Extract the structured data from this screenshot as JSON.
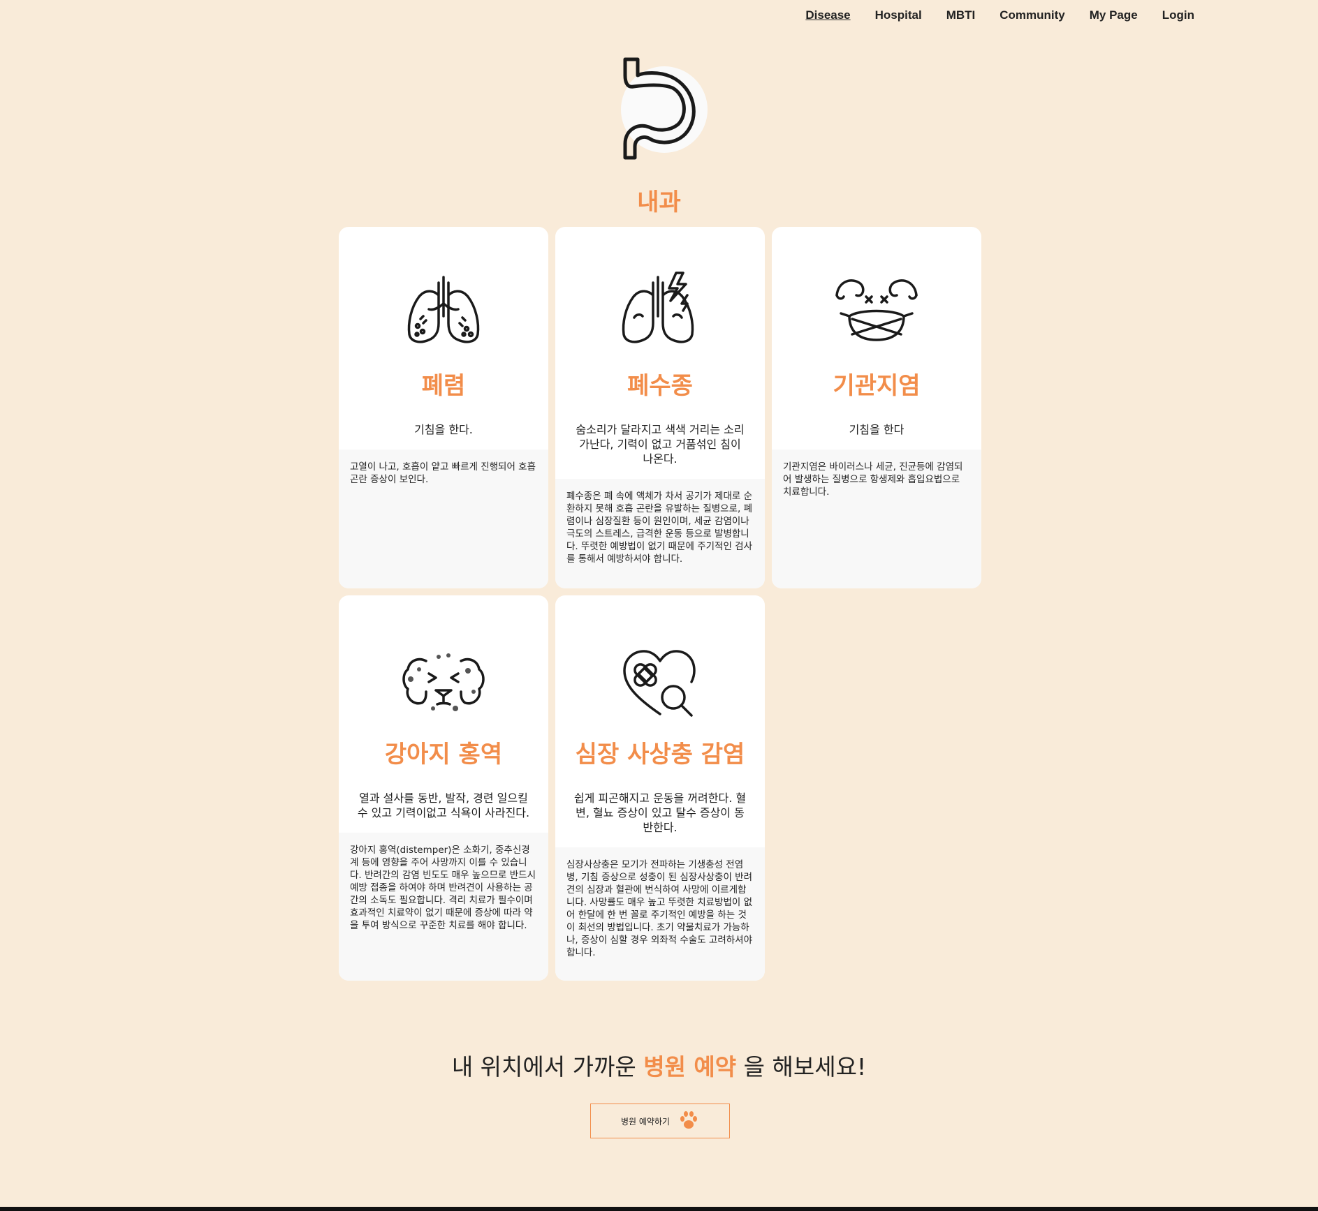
{
  "nav": {
    "items": [
      {
        "label": "Disease",
        "active": true
      },
      {
        "label": "Hospital"
      },
      {
        "label": "MBTI"
      },
      {
        "label": "Community"
      },
      {
        "label": "My Page"
      },
      {
        "label": "Login"
      }
    ]
  },
  "hero": {
    "icon": "stomach-icon",
    "title": "내과"
  },
  "accent_color": "#F28D4A",
  "background_color": "#F9EBD9",
  "cards": [
    {
      "icon": "lungs-icon",
      "title": "폐렴",
      "short": "기침을 한다.",
      "long": "고열이 나고, 호흡이 얕고 빠르게 진행되어 호흡곤란 증상이 보인다."
    },
    {
      "icon": "lungs-lightning-icon",
      "title": "폐수종",
      "short": "숨소리가 달라지고 색색 거리는 소리가난다, 기력이 없고 거품섞인 침이 나온다.",
      "long": "폐수종은 폐 속에 액체가 차서 공기가 제대로 순환하지 못해 호흡 곤란을 유발하는 질병으로, 폐렴이나 심장질환 등이 원인이며, 세균 감염이나 극도의 스트레스, 급격한 운동 등으로 발병합니다. 뚜렷한 예방법이 없기 때문에 주기적인 검사를 통해서 예방하셔야 합니다."
    },
    {
      "icon": "dog-mask-icon",
      "title": "기관지염",
      "short": "기침을 한다",
      "long": "기관지염은 바이러스나 세균, 진균등에 감염되어 발생하는 질병으로 항생제와 흡입요법으로 치료합니다."
    },
    {
      "icon": "sick-dog-icon",
      "title": "강아지 홍역",
      "short": "열과 설사를 동반, 발작, 경련 일으킬 수 있고 기력이없고 식욕이 사라진다.",
      "long": "강아지 홍역(distemper)은 소화기, 중추신경계 등에 영향을 주어 사망까지 이를 수 있습니다. 반려간의 감염 빈도도 매우 높으므로 반드시 예방 접종을 하여야 하며 반려견이 사용하는 공간의 소독도 필요합니다. 격리 치료가 필수이며 효과적인 치료약이 없기 때문에 증상에 따라 약을 투여 방식으로 꾸준한 치료를 해야 합니다."
    },
    {
      "icon": "heart-bandage-icon",
      "title": "심장 사상충 감염",
      "short": "쉽게 피곤해지고 운동을 꺼려한다. 혈변, 혈뇨 증상이 있고 탈수 증상이 동반한다.",
      "long": "심장사상충은 모기가 전파하는 기생충성 전염병, 기침 증상으로 성충이 된 심장사상충이 반려견의 심장과 혈관에 번식하여 사망에 이르게합니다. 사망률도 매우 높고 뚜렷한 치료방법이 없어 한달에 한 번 꼴로 주기적인 예방을 하는 것이 최선의 방법입니다. 초기 약물치료가 가능하나, 증상이 심할 경우 외좌적 수술도 고려하셔야 합니다."
    }
  ],
  "cta": {
    "prefix": "내 위치에서 가까운",
    "highlight": "병원 예약",
    "suffix": "을 해보세요!",
    "button_label": "병원 예약하기",
    "button_icon": "paw-icon"
  }
}
